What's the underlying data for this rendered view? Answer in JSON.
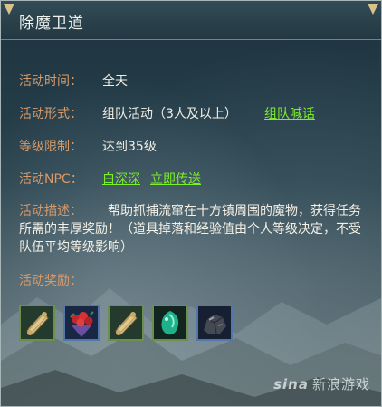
{
  "window": {
    "title": "除魔卫道"
  },
  "rows": {
    "time": {
      "label": "活动时间：",
      "value": "全天"
    },
    "form": {
      "label": "活动形式：",
      "value": "组队活动（3人及以上）",
      "link": "组队喊话"
    },
    "level": {
      "label": "等级限制：",
      "value": "达到35级"
    },
    "npc": {
      "label": "活动NPC：",
      "npc_name": "白深深",
      "teleport": "立即传送"
    },
    "desc": {
      "label": "活动描述：",
      "text": "帮助抓捕流窜在十方镇周围的魔物，获得任务所需的丰厚奖励！（道具掉落和经验值由个人等级决定，不受队伍平均等级影响）"
    },
    "reward": {
      "label": "活动奖励："
    }
  },
  "rewards": [
    {
      "icon": "scroll-icon",
      "frame": "green"
    },
    {
      "icon": "flower-bouquet-icon",
      "frame": "blue"
    },
    {
      "icon": "scroll-icon",
      "frame": "green"
    },
    {
      "icon": "jade-gem-icon",
      "frame": "green"
    },
    {
      "icon": "ore-stone-icon",
      "frame": "blue"
    }
  ],
  "watermark": {
    "brand": "sina",
    "text": "新浪游戏"
  },
  "colors": {
    "label": "#d99a69",
    "value": "#f3f0e6",
    "link": "#7cf02a",
    "title": "#eef2ee"
  }
}
